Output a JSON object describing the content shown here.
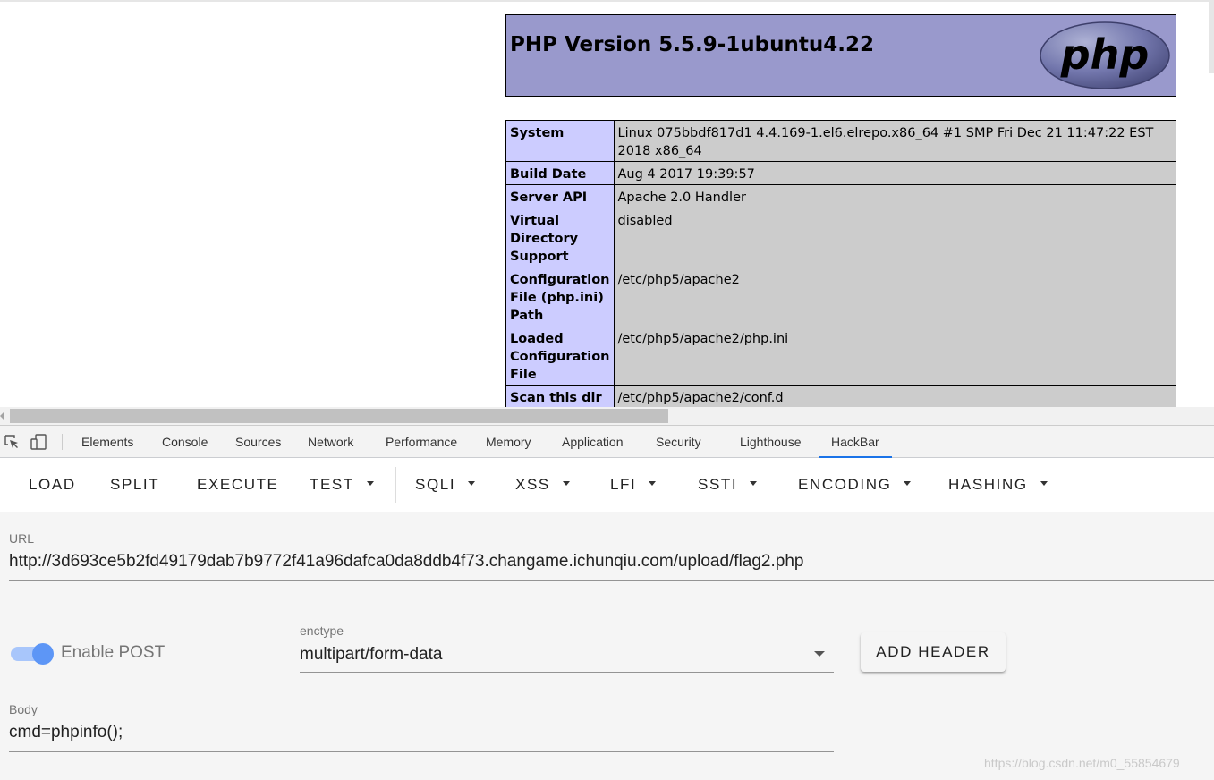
{
  "php_info": {
    "title": "PHP Version 5.5.9-1ubuntu4.22",
    "logo_text": "php",
    "rows": [
      {
        "key": "System",
        "value": "Linux 075bbdf817d1 4.4.169-1.el6.elrepo.x86_64 #1 SMP Fri Dec 21 11:47:22 EST 2018 x86_64"
      },
      {
        "key": "Build Date",
        "value": "Aug 4 2017 19:39:57"
      },
      {
        "key": "Server API",
        "value": "Apache 2.0 Handler"
      },
      {
        "key": "Virtual Directory Support",
        "value": "disabled"
      },
      {
        "key": "Configuration File (php.ini) Path",
        "value": "/etc/php5/apache2"
      },
      {
        "key": "Loaded Configuration File",
        "value": "/etc/php5/apache2/php.ini"
      },
      {
        "key": "Scan this dir",
        "value": "/etc/php5/apache2/conf.d"
      }
    ]
  },
  "devtools": {
    "tabs": [
      "Elements",
      "Console",
      "Sources",
      "Network",
      "Performance",
      "Memory",
      "Application",
      "Security",
      "Lighthouse",
      "HackBar"
    ],
    "active_tab": "HackBar"
  },
  "hackbar": {
    "toolbar": {
      "load": "LOAD",
      "split": "SPLIT",
      "execute": "EXECUTE",
      "test": "TEST",
      "sqli": "SQLI",
      "xss": "XSS",
      "lfi": "LFI",
      "ssti": "SSTI",
      "encoding": "ENCODING",
      "hashing": "HASHING"
    },
    "url_label": "URL",
    "url_value": "http://3d693ce5b2fd49179dab7b9772f41a96dafca0da8ddb4f73.changame.ichunqiu.com/upload/flag2.php",
    "enable_post_label": "Enable POST",
    "enable_post_on": true,
    "enctype_label": "enctype",
    "enctype_value": "multipart/form-data",
    "add_header_label": "ADD HEADER",
    "body_label": "Body",
    "body_value": "cmd=phpinfo();"
  },
  "watermark": "https://blog.csdn.net/m0_55854679",
  "colors": {
    "php_header_bg": "#9999cc",
    "key_cell_bg": "#ccccff",
    "value_cell_bg": "#cccccc",
    "active_tab_underline": "#1a73e8",
    "toggle_on": "#5d96f6"
  }
}
